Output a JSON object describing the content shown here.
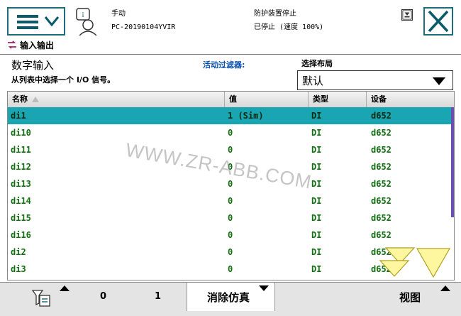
{
  "topbar": {
    "operation_mode": "手动",
    "controller_name": "PC-20190104YVIR",
    "status_line1": "防护装置停止",
    "status_line2": "已停止 (速度 100%)"
  },
  "window": {
    "title": "输入输出"
  },
  "header": {
    "title": "数字输入",
    "subtitle": "从列表中选择一个 I/O 信号。",
    "filter_label": "活动过滤器:",
    "layout_label": "选择布局",
    "layout_value": "默认"
  },
  "table": {
    "columns": [
      "名称",
      "值",
      "类型",
      "设备"
    ],
    "rows": [
      {
        "name": "di1",
        "value": "1 (Sim)",
        "type": "DI",
        "device": "d652",
        "selected": true
      },
      {
        "name": "di10",
        "value": "0",
        "type": "DI",
        "device": "d652"
      },
      {
        "name": "di11",
        "value": "0",
        "type": "DI",
        "device": "d652"
      },
      {
        "name": "di12",
        "value": "0",
        "type": "DI",
        "device": "d652"
      },
      {
        "name": "di13",
        "value": "0",
        "type": "DI",
        "device": "d652"
      },
      {
        "name": "di14",
        "value": "0",
        "type": "DI",
        "device": "d652"
      },
      {
        "name": "di15",
        "value": "0",
        "type": "DI",
        "device": "d652"
      },
      {
        "name": "di16",
        "value": "0",
        "type": "DI",
        "device": "d652"
      },
      {
        "name": "di2",
        "value": "0",
        "type": "DI",
        "device": "d652"
      },
      {
        "name": "di3",
        "value": "0",
        "type": "DI",
        "device": "d652"
      }
    ]
  },
  "watermark": "WWW.ZR-ABB.COM",
  "bottombar": {
    "value_0": "0",
    "value_1": "1",
    "simulate_label": "消除仿真",
    "view_label": "视图"
  },
  "colors": {
    "accent": "#1a6e7c",
    "selected_row": "#1aa5b3",
    "text_green": "#107010",
    "filter_blue": "#0a50b0",
    "scroll_arrow": "#fff6a0"
  }
}
